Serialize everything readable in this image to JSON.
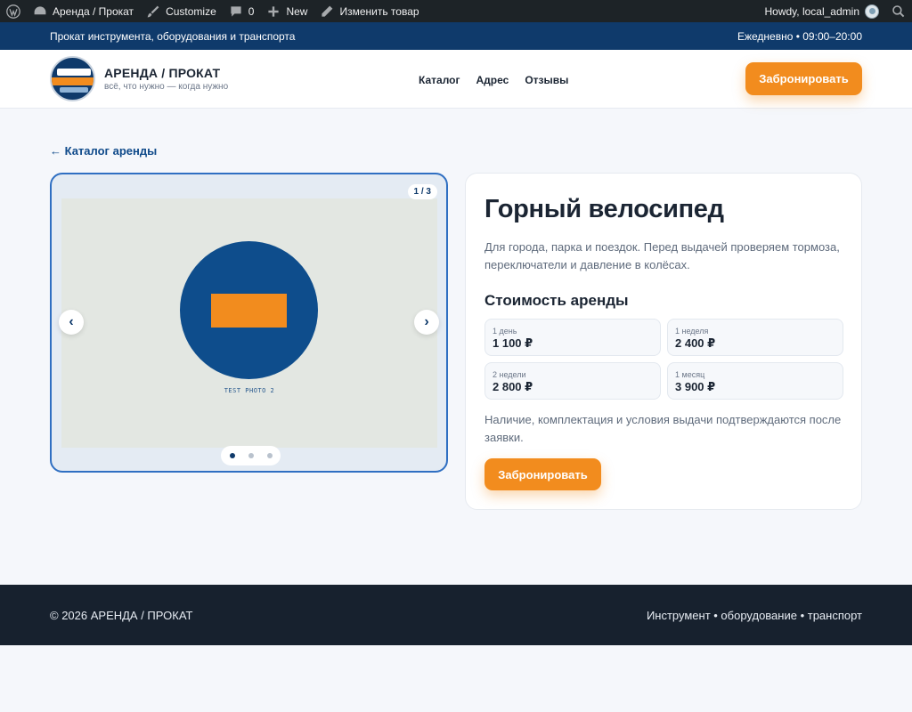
{
  "adminbar": {
    "site_name": "Аренда / Прокат",
    "customize": "Customize",
    "comments_count": "0",
    "new": "New",
    "edit_product": "Изменить товар",
    "howdy": "Howdy, local_admin"
  },
  "topbar": {
    "tagline": "Прокат инструмента, оборудования и транспорта",
    "hours": "Ежедневно • 09:00–20:00"
  },
  "header": {
    "brand_name": "АРЕНДА / ПРОКАТ",
    "brand_tagline": "всё, что нужно — когда нужно",
    "nav": [
      "Каталог",
      "Адрес",
      "Отзывы"
    ],
    "book_button": "Забронировать"
  },
  "back_link": "← Каталог аренды",
  "gallery": {
    "counter": "1 / 3",
    "photo_caption": "TEST PHOTO 2",
    "prev": "‹",
    "next": "›",
    "total_slides": 3,
    "active_slide": 1
  },
  "product": {
    "title": "Горный велосипед",
    "description": "Для города, парка и поездок. Перед выдачей проверяем тормоза, переключатели и давление в колёсах.",
    "price_title": "Стоимость аренды",
    "prices": [
      {
        "period": "1 день",
        "price": "1 100 ₽"
      },
      {
        "period": "1 неделя",
        "price": "2 400 ₽"
      },
      {
        "period": "2 недели",
        "price": "2 800 ₽"
      },
      {
        "period": "1 месяц",
        "price": "3 900 ₽"
      }
    ],
    "note": "Наличие, комплектация и условия выдачи подтверждаются после заявки.",
    "book_button": "Забронировать"
  },
  "footer": {
    "copyright": "© 2026 АРЕНДА / ПРОКАТ",
    "tagline": "Инструмент • оборудование • транспорт"
  },
  "colors": {
    "brand_blue": "#0f3a6b",
    "accent_orange": "#f28c1e",
    "footer_bg": "#17212e"
  }
}
